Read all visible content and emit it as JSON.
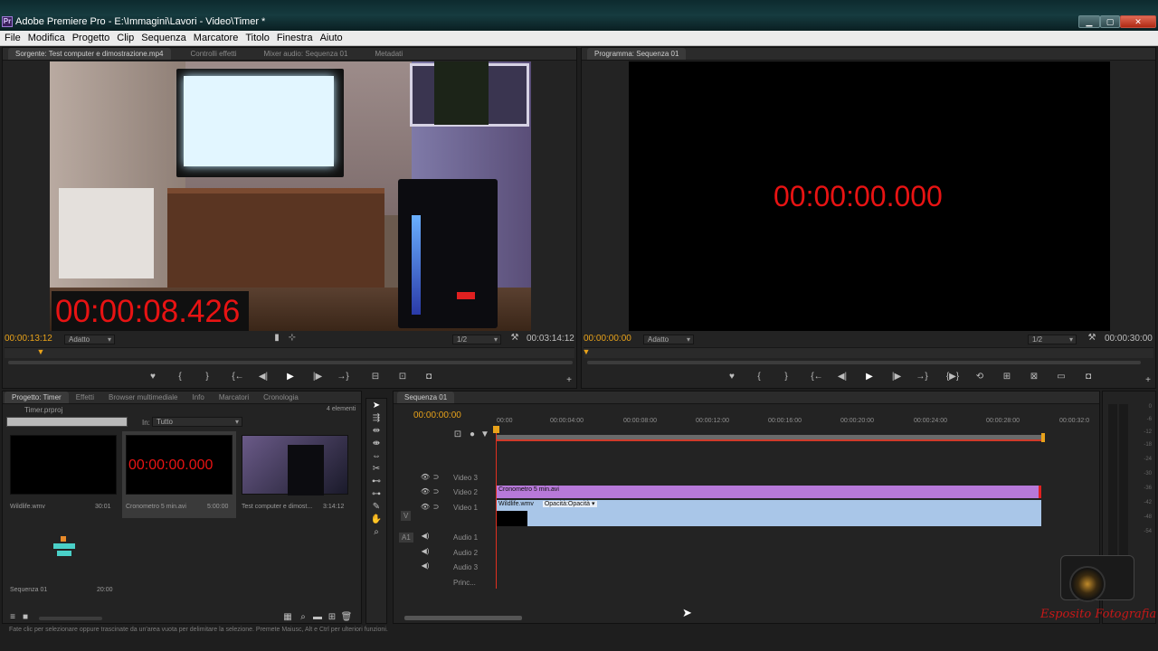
{
  "window": {
    "title": "Adobe Premiere Pro - E:\\Immagini\\Lavori - Video\\Timer *",
    "app_icon": "Pr"
  },
  "menu": [
    "File",
    "Modifica",
    "Progetto",
    "Clip",
    "Sequenza",
    "Marcatore",
    "Titolo",
    "Finestra",
    "Aiuto"
  ],
  "source_monitor": {
    "tabs": [
      "Sorgente: Test computer e dimostrazione.mp4",
      "Controlli effetti",
      "Mixer audio: Sequenza 01",
      "Metadati"
    ],
    "overlay_timecode": "00:00:08.426",
    "current_time": "00:00:13:12",
    "duration": "00:03:14:12",
    "fit": "Adatto",
    "resolution": "1/2"
  },
  "program_monitor": {
    "tab": "Programma: Sequenza 01",
    "display_timecode": "00:00:00.000",
    "current_time": "00:00:00:00",
    "duration": "00:00:30:00",
    "fit": "Adatto",
    "resolution": "1/2"
  },
  "project_panel": {
    "tabs": [
      "Progetto: Timer",
      "Effetti",
      "Browser multimediale",
      "Info",
      "Marcatori",
      "Cronologia"
    ],
    "file": "Timer.prproj",
    "count": "4 elementi",
    "in_label": "In:",
    "in_value": "Tutto",
    "items": [
      {
        "name": "Wildlife.wmv",
        "duration": "30:01"
      },
      {
        "name": "Cronometro 5 min.avi",
        "duration": "5:00:00",
        "preview_text": "00:00:00.000"
      },
      {
        "name": "Test computer e dimost...",
        "duration": "3:14:12"
      },
      {
        "name": "Sequenza 01",
        "duration": "20:00"
      }
    ]
  },
  "timeline": {
    "tab": "Sequenza 01",
    "current_time": "00:00:00:00",
    "ruler_labels": [
      "00:00",
      "00:00:04:00",
      "00:00:08:00",
      "00:00:12:00",
      "00:00:16:00",
      "00:00:20:00",
      "00:00:24:00",
      "00:00:28:00",
      "00:00:32:0"
    ],
    "tracks": [
      {
        "name": "Video 3"
      },
      {
        "name": "Video 2"
      },
      {
        "name": "Video 1"
      },
      {
        "name": "Audio 1"
      },
      {
        "name": "Audio 2"
      },
      {
        "name": "Audio 3"
      },
      {
        "name": "Princ..."
      }
    ],
    "track_tags": {
      "v": "V",
      "a": "A1"
    },
    "clips": {
      "video2": "Cronometro 5 min.avi",
      "video1": "Wildlife.wmv",
      "video1_fx": "Opacità:Opacità ▾"
    }
  },
  "meter_scale": [
    "0",
    "-6",
    "-12",
    "-18",
    "-24",
    "-30",
    "-36",
    "-42",
    "-48",
    "-54"
  ],
  "status": "Fate clic per selezionare oppure trascinate da un'area vuota per delimitare la selezione. Premete Maiusc, Alt e Ctrl per ulteriori funzioni.",
  "watermark": "Esposito Fotografia",
  "colors": {
    "timecode_red": "#e81313",
    "time_orange": "#e8a21a",
    "clip_purple": "#b779d9",
    "clip_blue": "#a9c6e8"
  }
}
